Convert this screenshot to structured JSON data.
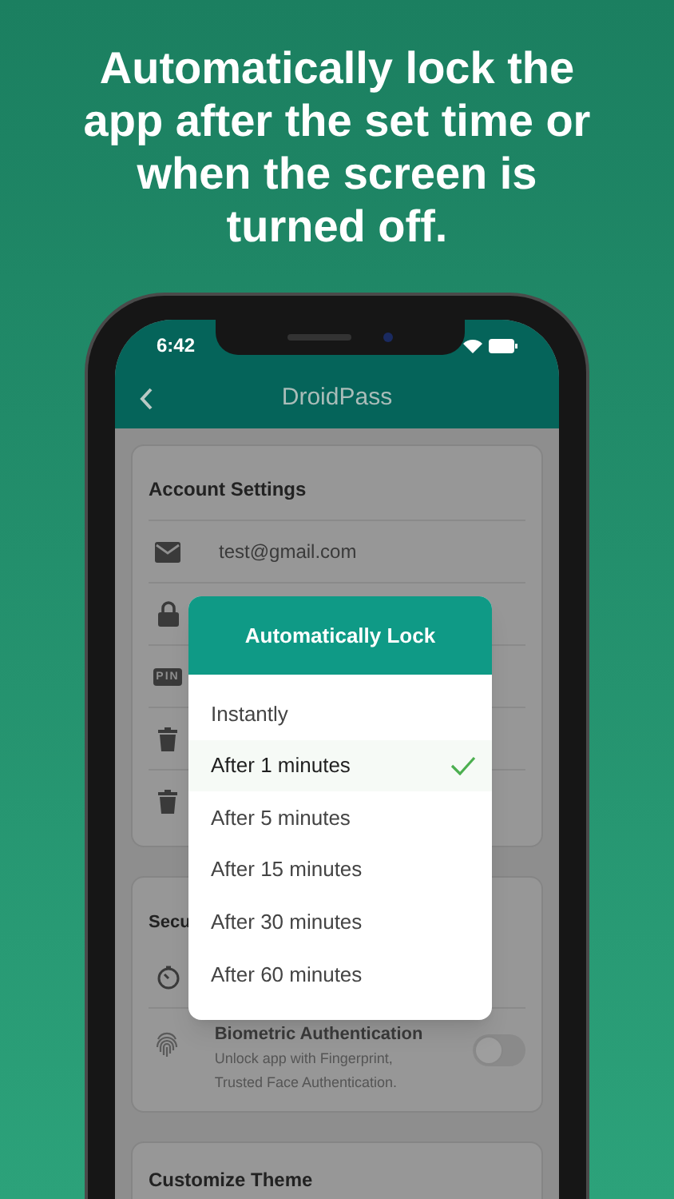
{
  "headline": "Automatically lock the app after the set time or when the screen is turned off.",
  "status_bar": {
    "time": "6:42"
  },
  "app_bar": {
    "title": "DroidPass"
  },
  "account_card": {
    "title": "Account Settings",
    "rows": [
      {
        "kind": "email",
        "text": "test@gmail.com"
      },
      {
        "kind": "lock"
      },
      {
        "kind": "pin",
        "badge": "PIN"
      },
      {
        "kind": "trash"
      },
      {
        "kind": "trash"
      }
    ]
  },
  "security_card": {
    "title": "Secu",
    "rows": [
      {
        "kind": "timer"
      },
      {
        "kind": "fingerprint",
        "title": "Biometric Authentication",
        "subtitle": "Unlock app with Fingerprint, Trusted Face Authentication.",
        "on": false
      }
    ]
  },
  "theme_card": {
    "title": "Customize Theme"
  },
  "dialog": {
    "title": "Automatically Lock",
    "options": [
      {
        "label": "Instantly",
        "selected": false
      },
      {
        "label": "After 1 minutes",
        "selected": true
      },
      {
        "label": "After 5 minutes",
        "selected": false
      },
      {
        "label": "After 15 minutes",
        "selected": false
      },
      {
        "label": "After 30 minutes",
        "selected": false
      },
      {
        "label": "After 60 minutes",
        "selected": false
      }
    ]
  }
}
